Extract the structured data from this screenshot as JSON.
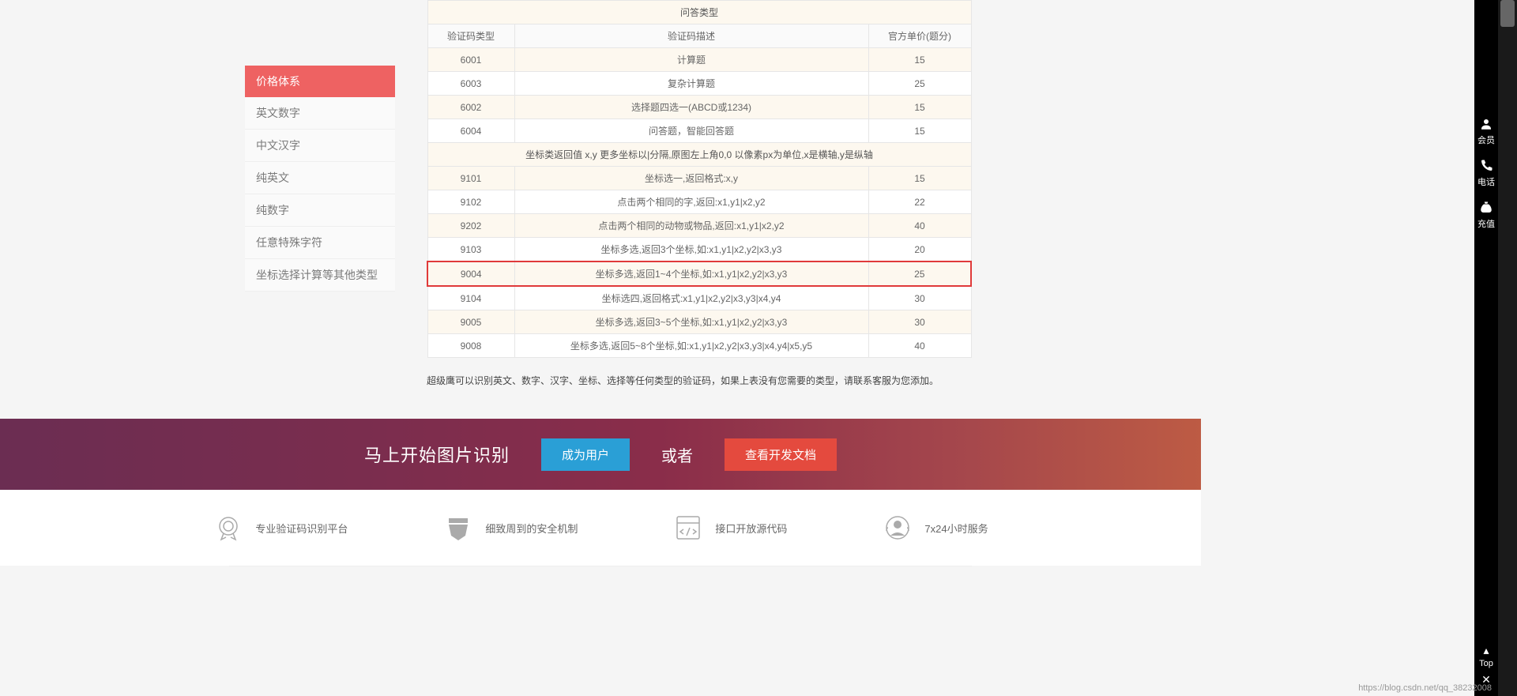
{
  "sidebar": {
    "items": [
      {
        "label": "价格体系",
        "active": true
      },
      {
        "label": "英文数字",
        "active": false
      },
      {
        "label": "中文汉字",
        "active": false
      },
      {
        "label": "纯英文",
        "active": false
      },
      {
        "label": "纯数字",
        "active": false
      },
      {
        "label": "任意特殊字符",
        "active": false
      },
      {
        "label": "坐标选择计算等其他类型",
        "active": false
      }
    ]
  },
  "table": {
    "section1_header": "问答类型",
    "col1": "验证码类型",
    "col2": "验证码描述",
    "col3": "官方单价(题分)",
    "rows1": [
      {
        "code": "6001",
        "desc": "计算题",
        "price": "15"
      },
      {
        "code": "6003",
        "desc": "复杂计算题",
        "price": "25"
      },
      {
        "code": "6002",
        "desc": "选择题四选一(ABCD或1234)",
        "price": "15"
      },
      {
        "code": "6004",
        "desc": "问答题，智能回答题",
        "price": "15"
      }
    ],
    "section2_header": "坐标类返回值 x,y 更多坐标以|分隔,原图左上角0,0 以像素px为单位,x是横轴,y是纵轴",
    "rows2": [
      {
        "code": "9101",
        "desc": "坐标选一,返回格式:x,y",
        "price": "15"
      },
      {
        "code": "9102",
        "desc": "点击两个相同的字,返回:x1,y1|x2,y2",
        "price": "22"
      },
      {
        "code": "9202",
        "desc": "点击两个相同的动物或物品,返回:x1,y1|x2,y2",
        "price": "40"
      },
      {
        "code": "9103",
        "desc": "坐标多选,返回3个坐标,如:x1,y1|x2,y2|x3,y3",
        "price": "20"
      },
      {
        "code": "9004",
        "desc": "坐标多选,返回1~4个坐标,如:x1,y1|x2,y2|x3,y3",
        "price": "25"
      },
      {
        "code": "9104",
        "desc": "坐标选四,返回格式:x1,y1|x2,y2|x3,y3|x4,y4",
        "price": "30"
      },
      {
        "code": "9005",
        "desc": "坐标多选,返回3~5个坐标,如:x1,y1|x2,y2|x3,y3",
        "price": "30"
      },
      {
        "code": "9008",
        "desc": "坐标多选,返回5~8个坐标,如:x1,y1|x2,y2|x3,y3|x4,y4|x5,y5",
        "price": "40"
      }
    ],
    "note": "超级鹰可以识别英文、数字、汉字、坐标、选择等任何类型的验证码，如果上表没有您需要的类型，请联系客服为您添加。"
  },
  "cta": {
    "title": "马上开始图片识别",
    "btn_user": "成为用户",
    "or": "或者",
    "btn_docs": "查看开发文档"
  },
  "features": [
    {
      "label": "专业验证码识别平台"
    },
    {
      "label": "细致周到的安全机制"
    },
    {
      "label": "接口开放源代码"
    },
    {
      "label": "7x24小时服务"
    }
  ],
  "rail": {
    "member": "会员",
    "phone": "电话",
    "recharge": "充值",
    "top": "Top"
  },
  "watermark": "https://blog.csdn.net/qq_38232008"
}
